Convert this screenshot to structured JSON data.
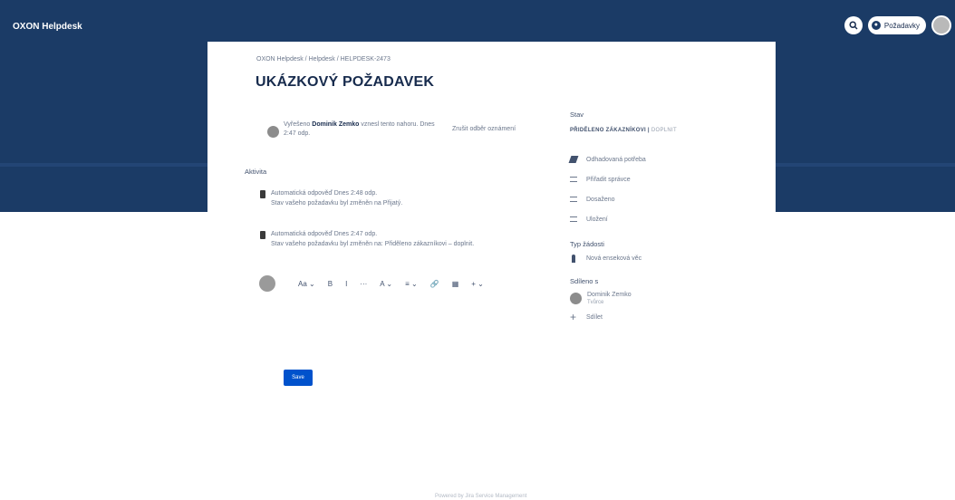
{
  "header": {
    "brand": "OXON Helpdesk",
    "requests_label": "Požadavky"
  },
  "request": {
    "breadcrumb": "OXON Helpdesk / Helpdesk / HELPDESK-2473",
    "title": "UKÁZKOVÝ POŽADAVEK",
    "raised_line_prefix": "Vyřešeno",
    "raised_by": "Dominik Zemko",
    "raised_line_suffix": "vznesl tento nahoru.",
    "raised_time": "Dnes 2:47 odp.",
    "notifications": "Zrušit odběr oznámení"
  },
  "activity": {
    "heading": "Aktivita",
    "items": [
      {
        "title": "Automatická odpověď",
        "time": "Dnes 2:48 odp.",
        "text": "Stav vašeho požadavku byl změněn na Přijatý."
      },
      {
        "title": "Automatická odpověď",
        "time": "Dnes 2:47 odp.",
        "text": "Stav vašeho požadavku byl změněn na: Přiděleno zákazníkovi – doplnit."
      }
    ]
  },
  "editor": {
    "toolbar": [
      "Aa ⌄",
      "B",
      "I",
      "···",
      "A ⌄",
      "≡ ⌄",
      "🔗",
      "▦",
      "+ ⌄"
    ],
    "save_label": "Save"
  },
  "sidebar": {
    "status_label": "Stav",
    "status_value": "PŘIDĚLENO ZÁKAZNÍKOVI",
    "status_tag": "DOPLNIT",
    "actions": [
      {
        "icon": "bolt-icon",
        "label": "Odhadovaná potřeba"
      },
      {
        "icon": "transition-icon",
        "label": "Přiřadit správce"
      },
      {
        "icon": "transition-icon",
        "label": "Dosaženo"
      },
      {
        "icon": "transition-icon",
        "label": "Uložení"
      }
    ],
    "type_label": "Typ žádosti",
    "type_value": "Nová enseková věc",
    "shared_label": "Sdíleno s",
    "shared_user": "Dominik Zemko",
    "shared_user_role": "Tvůrce",
    "share_action": "Sdílet"
  },
  "footer": {
    "text": "Powered by Jira Service Management"
  }
}
